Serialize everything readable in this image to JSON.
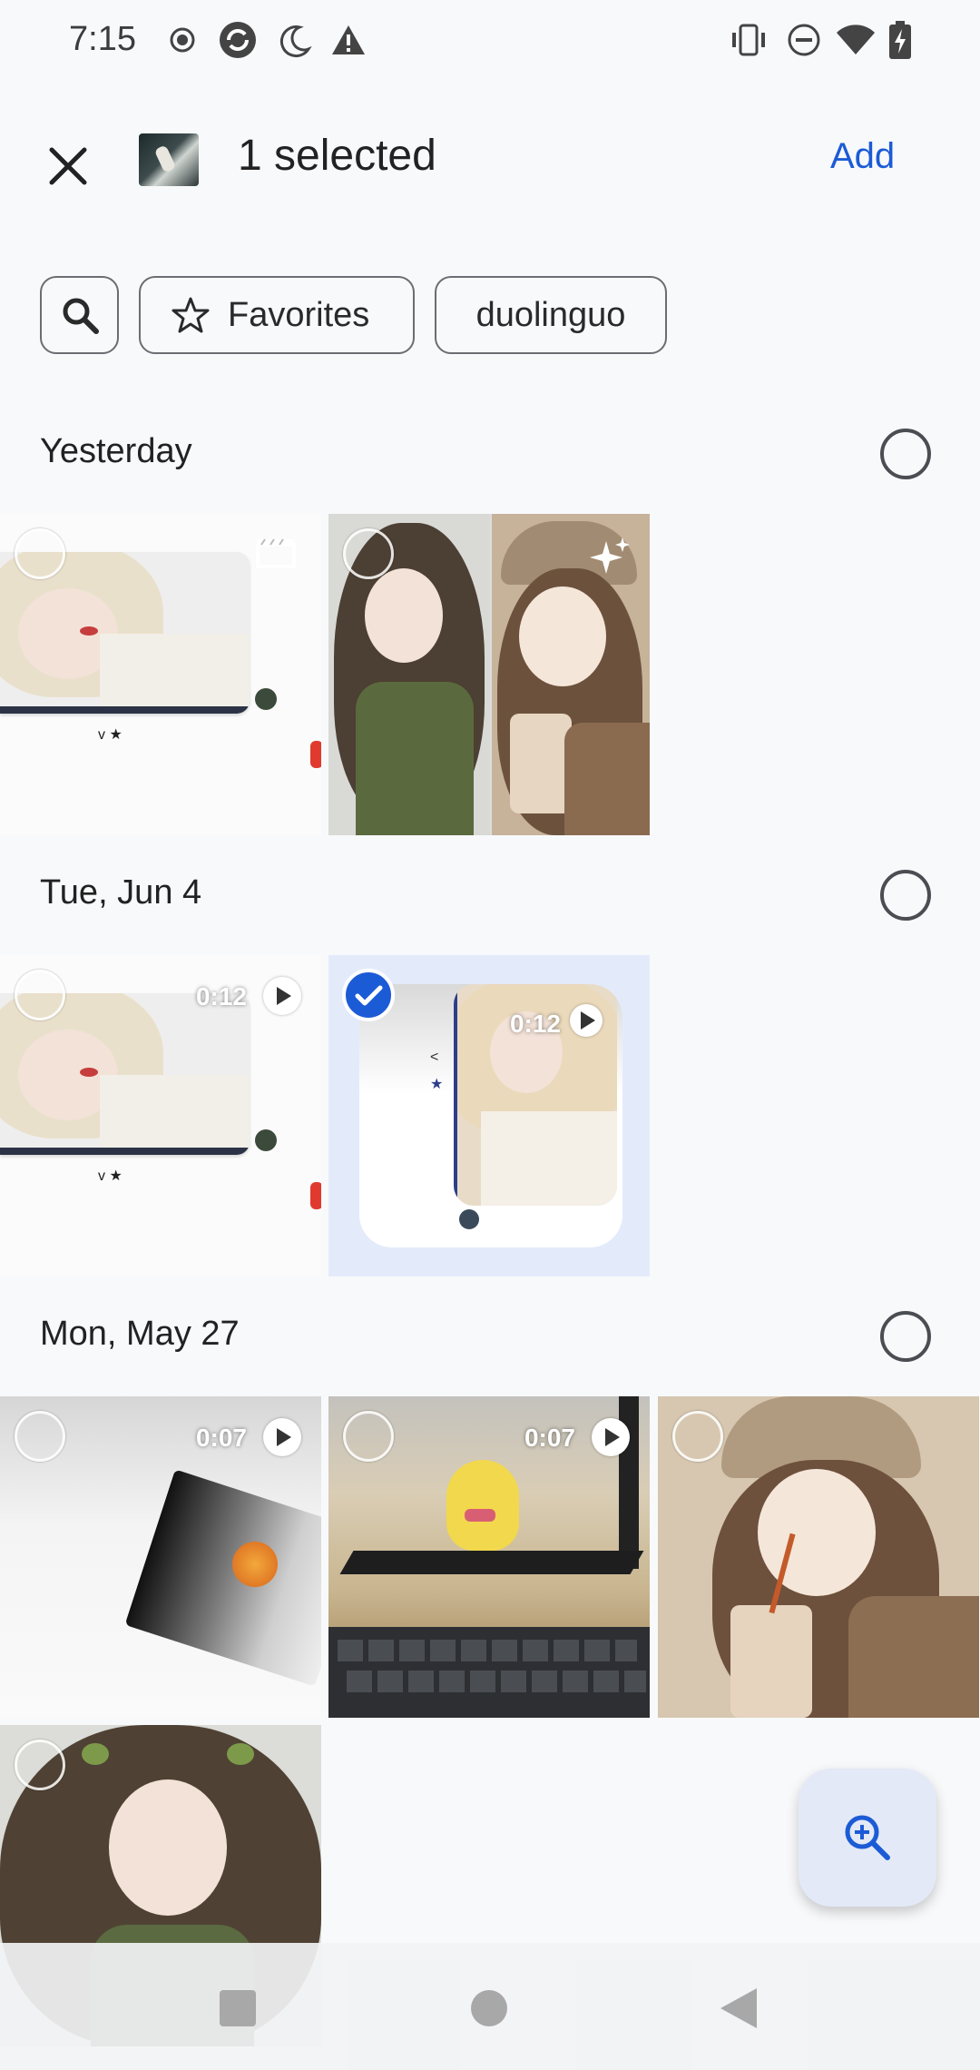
{
  "status_bar": {
    "time": "7:15"
  },
  "app_bar": {
    "selected_text": "1 selected",
    "add_label": "Add"
  },
  "chips": {
    "favorites": "Favorites",
    "duolinguo": "duolinguo"
  },
  "sections": [
    {
      "title": "Yesterday"
    },
    {
      "title": "Tue, Jun 4"
    },
    {
      "title": "Mon, May 27"
    }
  ],
  "videos": {
    "jun4_first": "0:12",
    "jun4_second": "0:12",
    "may27_first": "0:07",
    "may27_second": "0:07"
  },
  "colors": {
    "accent": "#1c5bd6",
    "selected_bg": "#e3ebfb",
    "fab_bg": "#e3e9f6"
  }
}
